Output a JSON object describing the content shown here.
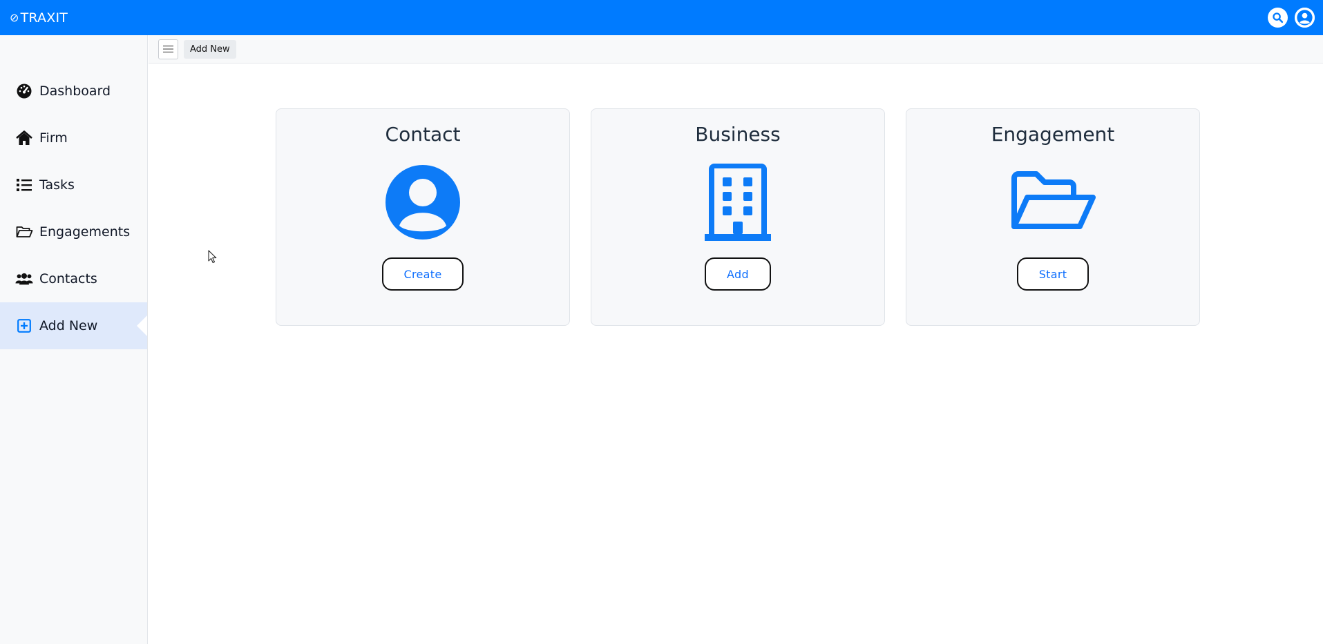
{
  "app": {
    "brand": "TRAXIT",
    "brand_mark": "⊘"
  },
  "colors": {
    "primary": "#007bff",
    "sidebar_active": "#dfe9fb",
    "button_text": "#0d6efd"
  },
  "topbar": {
    "search_icon": "search-icon",
    "user_icon": "user-circle-icon"
  },
  "sidebar": {
    "items": [
      {
        "label": "Dashboard",
        "icon": "speedometer-icon"
      },
      {
        "label": "Firm",
        "icon": "home-icon"
      },
      {
        "label": "Tasks",
        "icon": "list-icon"
      },
      {
        "label": "Engagements",
        "icon": "folder-open-icon"
      },
      {
        "label": "Contacts",
        "icon": "users-icon"
      },
      {
        "label": "Add New",
        "icon": "plus-square-icon",
        "active": true
      }
    ]
  },
  "toolbar": {
    "breadcrumb": "Add New"
  },
  "cards": [
    {
      "title": "Contact",
      "icon": "user-circle-icon",
      "button": "Create"
    },
    {
      "title": "Business",
      "icon": "building-icon",
      "button": "Add"
    },
    {
      "title": "Engagement",
      "icon": "folder-open-icon",
      "button": "Start"
    }
  ]
}
